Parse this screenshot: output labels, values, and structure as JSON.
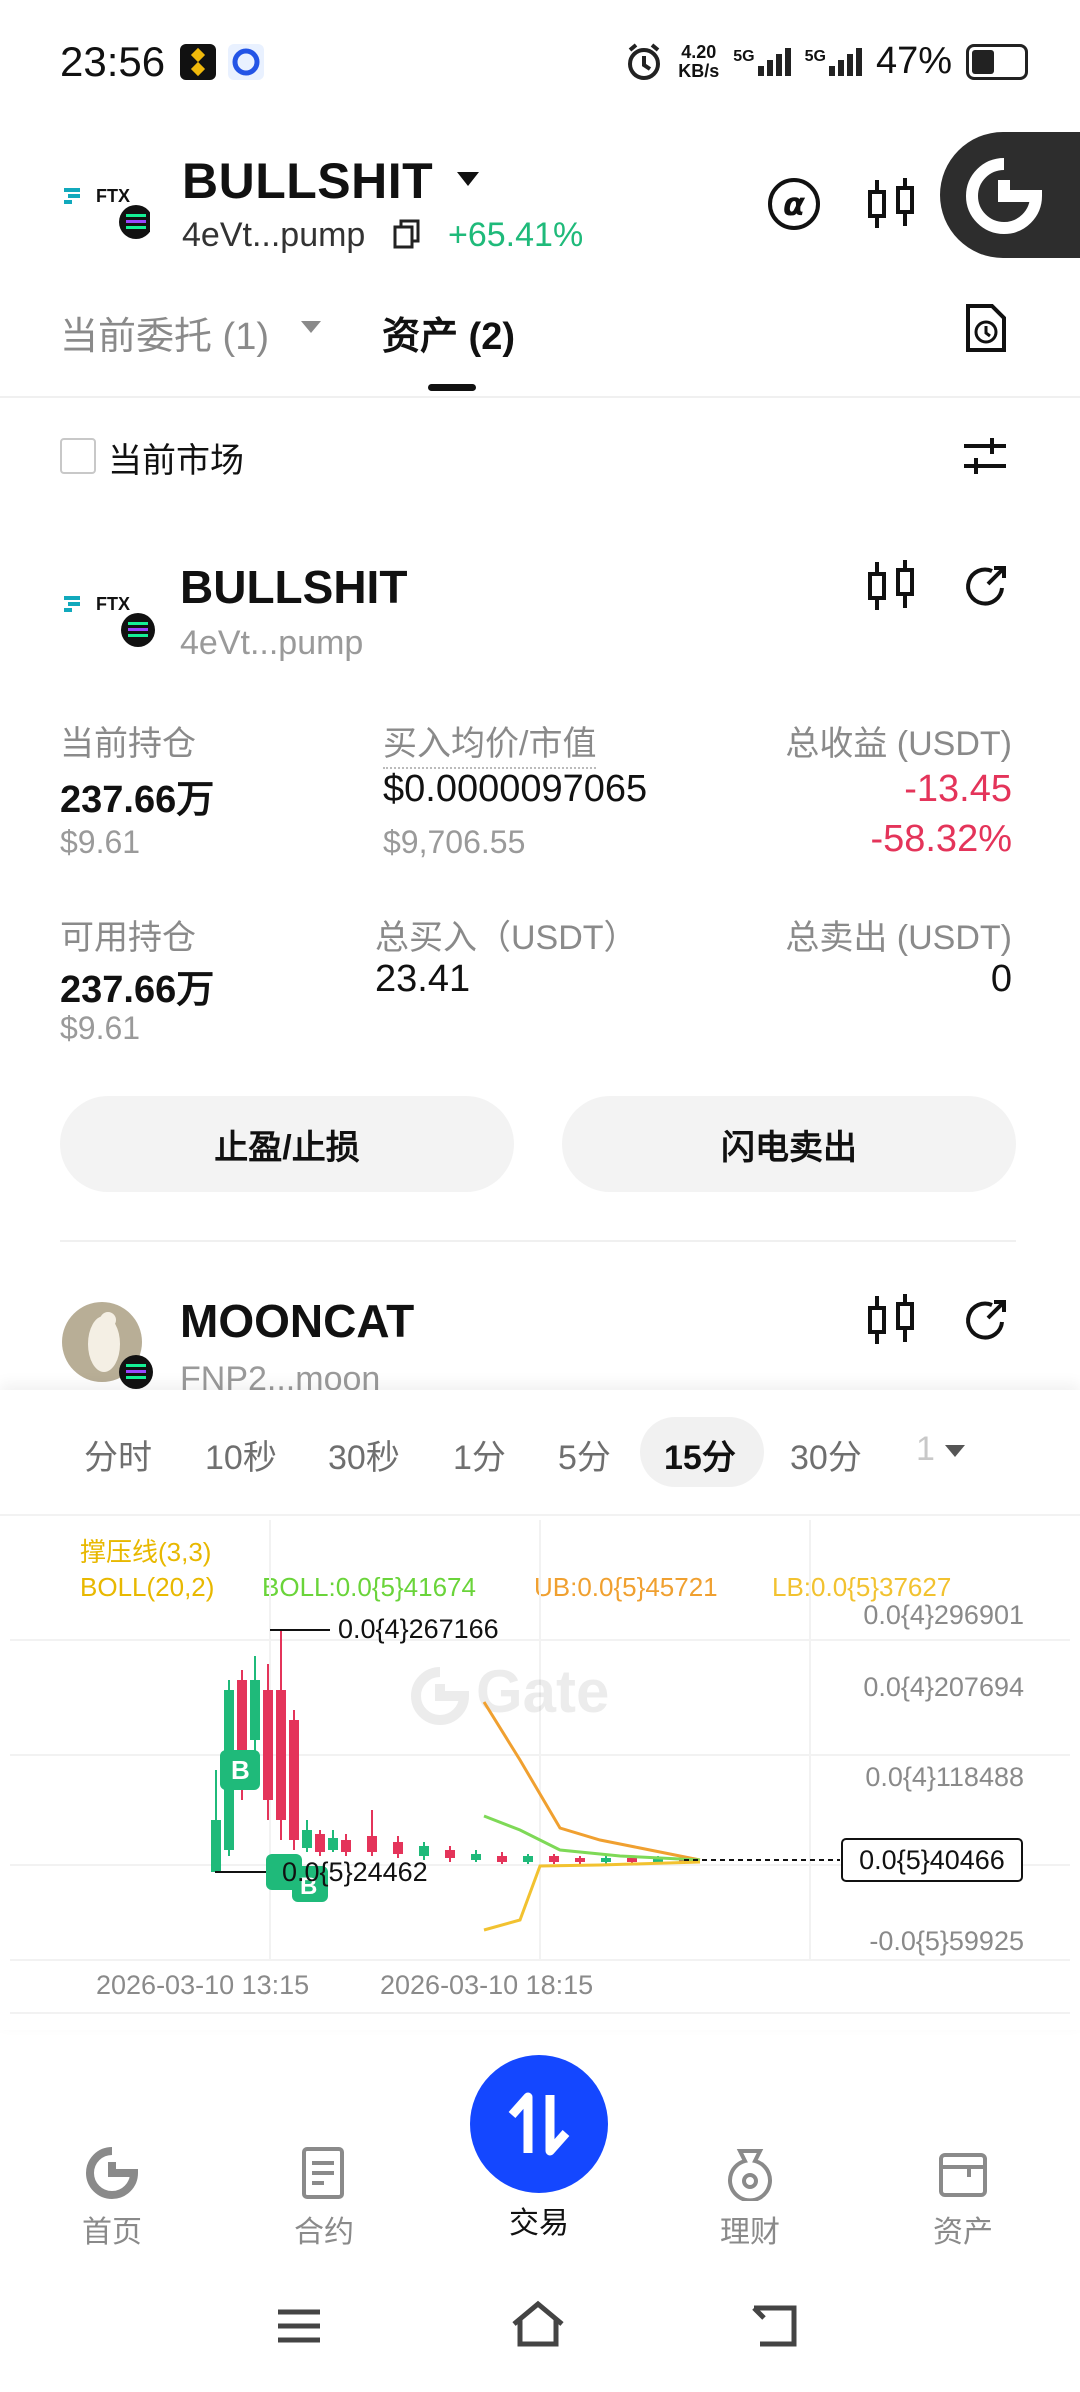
{
  "status_bar": {
    "time": "23:56",
    "net_speed_top": "4.20",
    "net_speed_bottom": "KB/s",
    "signal1": "5G",
    "signal2": "5G",
    "battery": "47%"
  },
  "header": {
    "title": "BULLSHIT",
    "address": "4eVt...pump",
    "change": "+65.41%",
    "exchange_logo_text": "FTX"
  },
  "tabs": {
    "orders": "当前委托 (1)",
    "assets": "资产 (2)"
  },
  "filter": {
    "current_market": "当前市场"
  },
  "asset1": {
    "name": "BULLSHIT",
    "address": "4eVt...pump",
    "logo_text": "FTX",
    "holding_label": "当前持仓",
    "holding_value": "237.66万",
    "holding_usd": "$9.61",
    "avg_label": "买入均价/市值",
    "avg_value": "$0.0000097065",
    "market_value": "$9,706.55",
    "pnl_label": "总收益 (USDT)",
    "pnl_value": "-13.45",
    "pnl_pct": "-58.32%",
    "avail_label": "可用持仓",
    "avail_value": "237.66万",
    "avail_usd": "$9.61",
    "bought_label": "总买入（USDT）",
    "bought_value": "23.41",
    "sold_label": "总卖出 (USDT)",
    "sold_value": "0",
    "tpsl_btn": "止盈/止损",
    "flash_sell_btn": "闪电卖出"
  },
  "asset2": {
    "name": "MOONCAT",
    "address": "FNP2...moon"
  },
  "timeframes": [
    "分时",
    "10秒",
    "30秒",
    "1分",
    "5分",
    "15分",
    "30分",
    "1"
  ],
  "active_timeframe": "15分",
  "chart": {
    "indicator1": "撑压线(3,3)",
    "boll": "BOLL(20,2)",
    "boll_mid": "BOLL:0.0{5}41674",
    "boll_ub": "UB:0.0{5}45721",
    "boll_lb": "LB:0.0{5}37627",
    "high_marker": "0.0{4}267166",
    "low_marker": "0.0{5}24462",
    "current_price": "0.0{5}40466",
    "y_ticks": [
      "0.0{4}296901",
      "0.0{4}207694",
      "0.0{4}118488",
      "-0.0{5}59925"
    ],
    "x_ticks": [
      "2026-03-10 13:15",
      "2026-03-10 18:15"
    ],
    "buy_marker": "B",
    "watermark": "Gate",
    "colors": {
      "up": "#1fba7a",
      "down": "#e4345a",
      "ub": "#f0a030",
      "mid": "#7ed957",
      "lb": "#f2c230",
      "indicator": "#e8b800"
    }
  },
  "bottom_nav": [
    {
      "label": "首页",
      "icon": "home-icon"
    },
    {
      "label": "合约",
      "icon": "contract-icon"
    },
    {
      "label": "交易",
      "icon": "trade-icon"
    },
    {
      "label": "理财",
      "icon": "finance-icon"
    },
    {
      "label": "资产",
      "icon": "wallet-icon"
    }
  ]
}
